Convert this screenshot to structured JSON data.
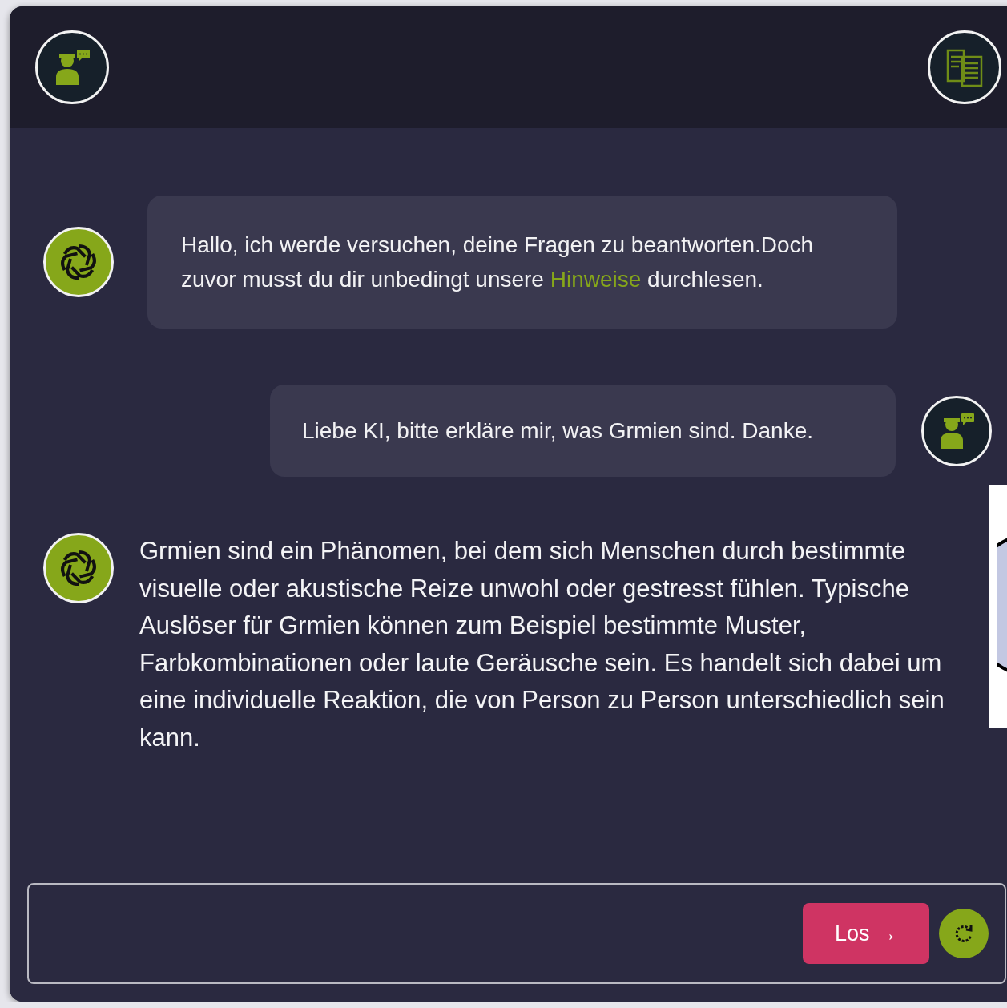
{
  "messages": [
    {
      "kind": "bot_bubble",
      "segments": [
        {
          "text": "Hallo, ich werde versuchen, deine Fragen zu beantworten.Doch zuvor musst du dir unbedingt unsere ",
          "link": false
        },
        {
          "text": "Hinweise",
          "link": true
        },
        {
          "text": " durchlesen.",
          "link": false
        }
      ]
    },
    {
      "kind": "user_bubble",
      "segments": [
        {
          "text": "Liebe KI, bitte erkläre mir, was Grmien sind. Danke.",
          "link": false
        }
      ]
    },
    {
      "kind": "bot_plain",
      "segments": [
        {
          "text": "Grmien sind ein Phänomen, bei dem sich Menschen durch bestimmte visuelle oder akustische Reize unwohl oder gestresst fühlen. Typische Auslöser für Grmien können zum Beispiel bestimmte Muster, Farbkombinationen oder laute Geräusche sein. Es handelt sich dabei um eine individuelle Reaktion, die von Person zu Person unterschiedlich sein kann.",
          "link": false
        }
      ]
    }
  ],
  "composer": {
    "send_label": "Los →"
  }
}
